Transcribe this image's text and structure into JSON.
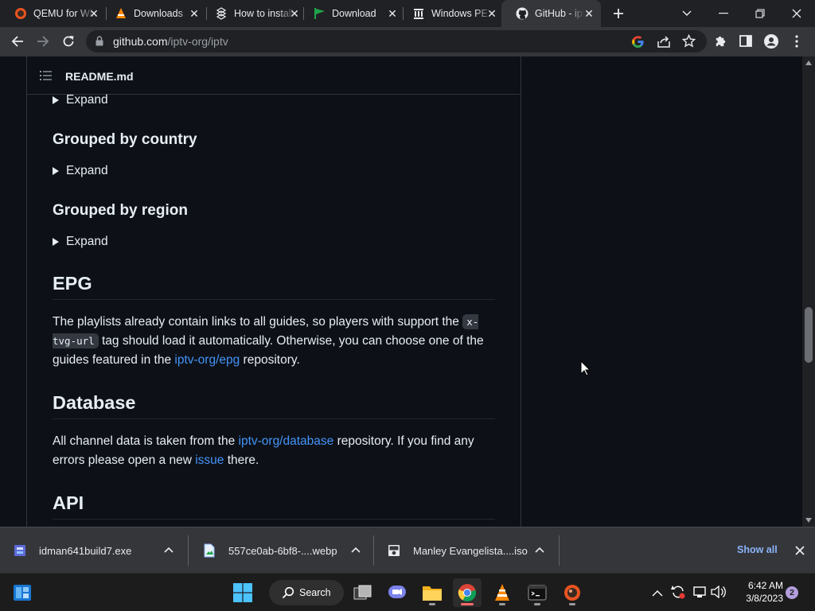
{
  "tabs": [
    {
      "title": "QEMU for Windows",
      "icon": "qemu-icon"
    },
    {
      "title": "Downloads",
      "icon": "vlc-cone-icon"
    },
    {
      "title": "How to install",
      "icon": "wikihow-icon"
    },
    {
      "title": "Download",
      "icon": "green-flag-icon"
    },
    {
      "title": "Windows PE",
      "icon": "archive-org-icon"
    },
    {
      "title": "GitHub - iptv-org/iptv",
      "icon": "github-icon",
      "active": true
    }
  ],
  "address_bar": {
    "domain": "github.com",
    "path": "/iptv-org/iptv"
  },
  "readme": {
    "file_label": "README.md",
    "expand_label": "Expand",
    "grouped_by_country": "Grouped by country",
    "grouped_by_region": "Grouped by region",
    "epg_heading": "EPG",
    "epg_para": {
      "t1": "The playlists already contain links to all guides, so players with support the ",
      "code": "x-tvg-url",
      "t2": " tag should load it automatically. Otherwise, you can choose one of the guides featured in the ",
      "link": "iptv-org/epg",
      "t3": " repository."
    },
    "database_heading": "Database",
    "database_para": {
      "t1": "All channel data is taken from the ",
      "link1": "iptv-org/database",
      "t2": " repository. If you find any errors please open a new ",
      "link2": "issue",
      "t3": " there."
    },
    "api_heading": "API"
  },
  "downloads": [
    {
      "name": "idman641build7.exe",
      "icon": "installer-icon"
    },
    {
      "name": "557ce0ab-6bf8-....webp",
      "icon": "image-file-icon"
    },
    {
      "name": "Manley Evangelista....iso",
      "icon": "iso-disc-icon"
    }
  ],
  "downloads_show_all": "Show all",
  "taskbar": {
    "search_label": "Search",
    "time": "6:42 AM",
    "date": "3/8/2023",
    "notification_count": "2"
  },
  "colors": {
    "link": "#4493f8",
    "page_bg": "#0d1117",
    "chrome_toolbar": "#35363a"
  }
}
